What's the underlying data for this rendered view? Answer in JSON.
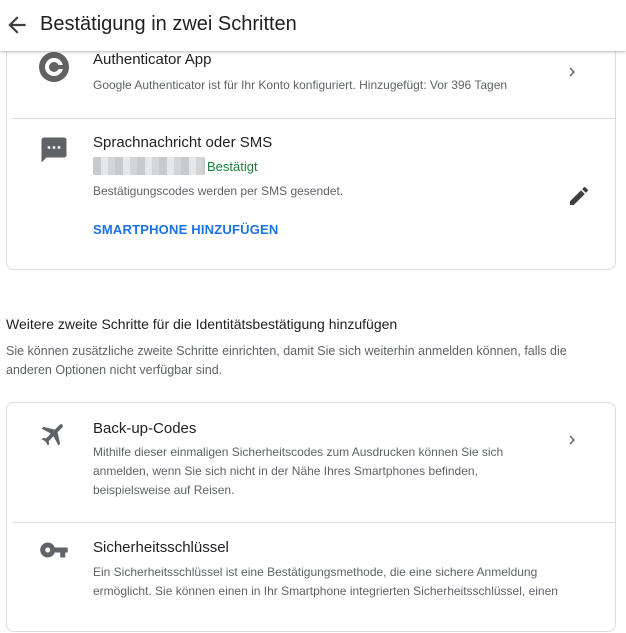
{
  "header": {
    "back_icon": "arrow-left-icon",
    "title": "Bestätigung in zwei Schritten"
  },
  "methods": {
    "authenticator": {
      "icon": "google-authenticator-icon",
      "title": "Authenticator App",
      "description": "Google Authenticator ist für Ihr Konto konfiguriert. Hinzugefügt: Vor 396 Tagen"
    },
    "sms": {
      "icon": "message-icon",
      "title": "Sprachnachricht oder SMS",
      "status": "Bestätigt",
      "description": "Bestätigungscodes werden per SMS gesendet.",
      "action": "SMARTPHONE HINZUFÜGEN",
      "edit_icon": "pencil-icon"
    }
  },
  "additional": {
    "title": "Weitere zweite Schritte für die Identitätsbestätigung hinzufügen",
    "description": "Sie können zusätzliche zweite Schritte einrichten, damit Sie sich weiterhin anmelden können, falls die anderen Optionen nicht verfügbar sind.",
    "backup_codes": {
      "icon": "airplane-icon",
      "title": "Back-up-Codes",
      "description": "Mithilfe dieser einmaligen Sicherheitscodes zum Ausdrucken können Sie sich anmelden, wenn Sie sich nicht in der Nähe Ihres Smartphones befinden, beispielsweise auf Reisen."
    },
    "security_key": {
      "icon": "key-icon",
      "title": "Sicherheitsschlüssel",
      "description": "Ein Sicherheitsschlüssel ist eine Bestätigungsmethode, die eine sichere Anmeldung ermöglicht. Sie können einen in Ihr Smartphone integrierten Sicherheitsschlüssel, einen"
    }
  },
  "colors": {
    "link": "#1a73e8",
    "success": "#188038",
    "icon": "#5f6368",
    "divider": "#dadce0"
  }
}
